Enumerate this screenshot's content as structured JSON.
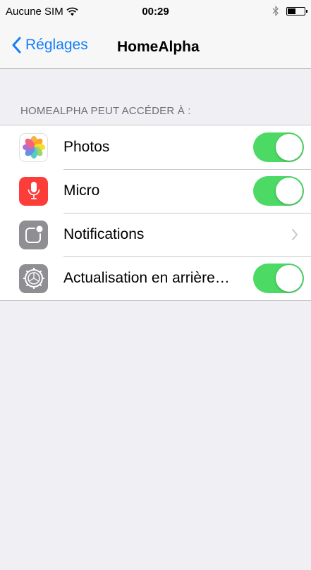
{
  "status_bar": {
    "carrier": "Aucune SIM",
    "time": "00:29"
  },
  "nav": {
    "back_label": "Réglages",
    "title": "HomeAlpha"
  },
  "section_header": "HOMEALPHA PEUT ACCÉDER À :",
  "rows": [
    {
      "label": "Photos",
      "icon": "photos-icon",
      "control": "toggle",
      "on": true
    },
    {
      "label": "Micro",
      "icon": "microphone-icon",
      "control": "toggle",
      "on": true
    },
    {
      "label": "Notifications",
      "icon": "notifications-icon",
      "control": "chevron"
    },
    {
      "label": "Actualisation en arrière…",
      "icon": "settings-gear-icon",
      "control": "toggle",
      "on": true
    }
  ],
  "colors": {
    "accent": "#157efb",
    "toggle_on": "#4cd964",
    "background": "#efeff4",
    "mic_icon_bg": "#fc3d39",
    "gray_icon_bg": "#8e8e93"
  }
}
